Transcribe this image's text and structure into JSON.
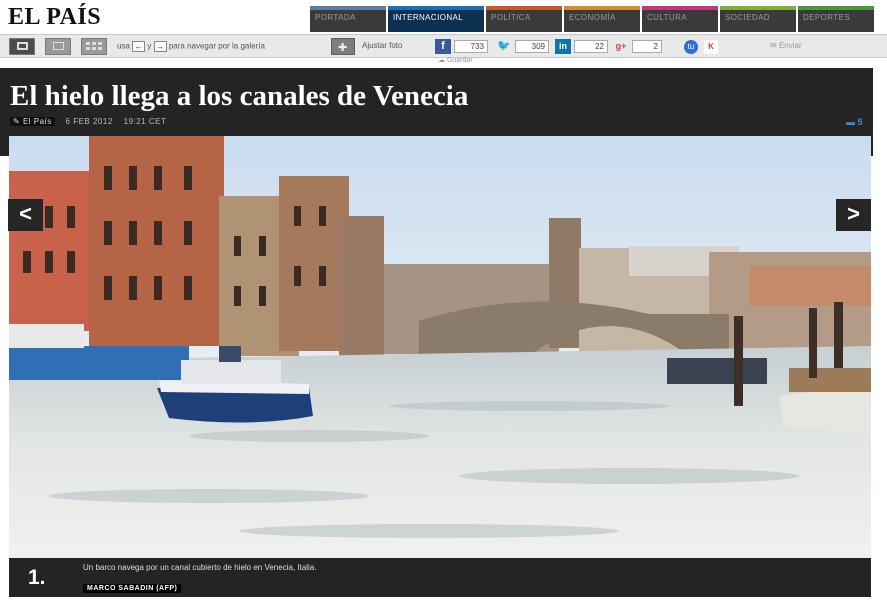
{
  "site": {
    "logo": "EL PAÍS"
  },
  "sections": [
    {
      "label": "PORTADA",
      "color": "#5a7fa6"
    },
    {
      "label": "INTERNACIONAL",
      "color": "#1a6fb5"
    },
    {
      "label": "POLÍTICA",
      "color": "#c85a2a"
    },
    {
      "label": "ECONOMÍA",
      "color": "#d68a2a"
    },
    {
      "label": "CULTURA",
      "color": "#c23a7a"
    },
    {
      "label": "SOCIEDAD",
      "color": "#7fae3a"
    },
    {
      "label": "DEPORTES",
      "color": "#4a9a3a"
    }
  ],
  "toolbar": {
    "nav_prefix": "usa",
    "nav_mid": "y",
    "nav_suffix": "para navegar por la galería",
    "key_left": "←",
    "key_right": "→",
    "fit_label": "Ajustar foto",
    "facebook_count": "733",
    "twitter_count": "309",
    "linkedin_count": "22",
    "gplus_count": "2",
    "print_label": "Enviar",
    "save_label": "Guardar"
  },
  "icons": {
    "grid_views": [
      "single-view-icon",
      "medium-view-icon",
      "thumbnail-grid-icon"
    ],
    "fit": "fit-photo-icon",
    "facebook": "facebook-icon",
    "twitter": "twitter-icon",
    "linkedin": "linkedin-icon",
    "gplus": "google-plus-icon",
    "tuenti": "tuenti-icon",
    "meneame": "meneame-icon",
    "print": "envelope-icon"
  },
  "article": {
    "title": "El hielo llega a los canales de Venecia",
    "source": "El País",
    "date": "6 FEB 2012",
    "time": "19:21 CET",
    "comment_count": "5"
  },
  "gallery": {
    "prev": "<",
    "next": ">",
    "index": "1.",
    "caption": "Un barco navega por un canal cubierto de hielo en Venecia, Italia.",
    "credit": "MARCO SABADIN (AFP)"
  }
}
